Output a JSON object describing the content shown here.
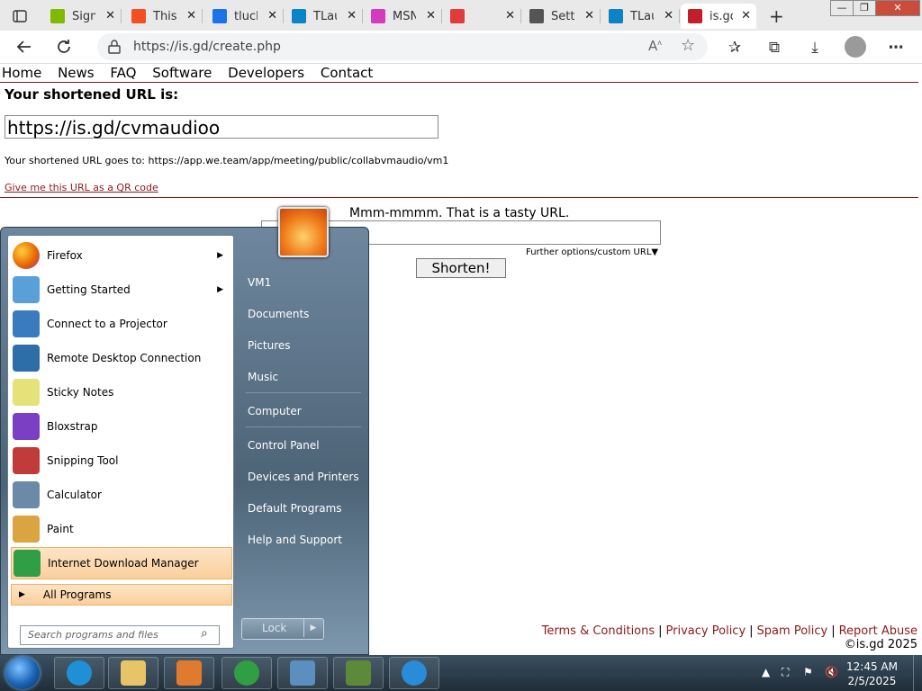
{
  "browser": {
    "tabs": [
      {
        "label": "Sign",
        "color": "#7fba00"
      },
      {
        "label": "This",
        "color": "#f25022"
      },
      {
        "label": "tluch",
        "color": "#1a73e8"
      },
      {
        "label": "TLau",
        "color": "#0a84c6"
      },
      {
        "label": "MSN",
        "color": "#d43cbe"
      },
      {
        "label": "",
        "color": "#e23b3b"
      },
      {
        "label": "Setti",
        "color": "#555555"
      },
      {
        "label": "TLau",
        "color": "#0a84c6"
      },
      {
        "label": "is.gd",
        "color": "#c41e2a"
      }
    ],
    "new_tab_glyph": "+",
    "url": "https://is.gd/create.php",
    "minimize": "—",
    "restore": "❐",
    "close": "✕"
  },
  "page": {
    "menu": [
      "Home",
      "News",
      "FAQ",
      "Software",
      "Developers",
      "Contact"
    ],
    "heading": "Your shortened URL is:",
    "short_url": "https://is.gd/cvmaudioo",
    "goes_to": "Your shortened URL goes to: https://app.we.team/app/meeting/public/collabvmaudio/vm1",
    "qr_link": "Give me this URL as a QR code",
    "tasty": "Mmm-mmmm. That is a tasty URL.",
    "further_options": "Further options/custom URL▼",
    "shorten_button": "Shorten!",
    "footer_links": [
      "Terms & Conditions",
      "Privacy Policy",
      "Spam Policy",
      "Report Abuse"
    ],
    "copyright": "©is.gd 2025"
  },
  "start_menu": {
    "programs": [
      {
        "label": "Firefox",
        "submenu": true,
        "icon": "firefox-icon",
        "color": "#e66000"
      },
      {
        "label": "Getting Started",
        "submenu": true,
        "icon": "getting-started-icon",
        "color": "#5aa0d8"
      },
      {
        "label": "Connect to a Projector",
        "submenu": false,
        "icon": "projector-icon",
        "color": "#3a7bbf"
      },
      {
        "label": "Remote Desktop Connection",
        "submenu": false,
        "icon": "remote-desktop-icon",
        "color": "#2d6ea8"
      },
      {
        "label": "Sticky Notes",
        "submenu": false,
        "icon": "sticky-notes-icon",
        "color": "#e6e27a"
      },
      {
        "label": "Bloxstrap",
        "submenu": false,
        "icon": "bloxstrap-icon",
        "color": "#7b3fc4"
      },
      {
        "label": "Snipping Tool",
        "submenu": false,
        "icon": "snipping-tool-icon",
        "color": "#c23b3b"
      },
      {
        "label": "Calculator",
        "submenu": false,
        "icon": "calculator-icon",
        "color": "#6a8aa8"
      },
      {
        "label": "Paint",
        "submenu": false,
        "icon": "paint-icon",
        "color": "#d9a441"
      },
      {
        "label": "Internet Download Manager",
        "submenu": false,
        "icon": "idm-icon",
        "color": "#2f9e44"
      }
    ],
    "all_programs": "All Programs",
    "search_placeholder": "Search programs and files",
    "right_items": [
      "VM1",
      "Documents",
      "Pictures",
      "Music",
      "Computer",
      "Control Panel",
      "Devices and Printers",
      "Default Programs",
      "Help and Support"
    ],
    "lock_button": "Lock"
  },
  "taskbar": {
    "time": "12:45 AM",
    "date": "2/5/2025",
    "pinned": [
      {
        "icon": "edge-icon",
        "color": "#1f8fd6"
      },
      {
        "icon": "file-explorer-icon",
        "color": "#e8c468"
      },
      {
        "icon": "media-player-icon",
        "color": "#e07a2e"
      },
      {
        "icon": "download-manager-icon",
        "color": "#2f9e44"
      },
      {
        "icon": "control-panel-icon",
        "color": "#5b8fc0"
      },
      {
        "icon": "minecraft-icon",
        "color": "#5c8a3a"
      },
      {
        "icon": "internet-explorer-icon",
        "color": "#2a8bd8"
      }
    ]
  }
}
